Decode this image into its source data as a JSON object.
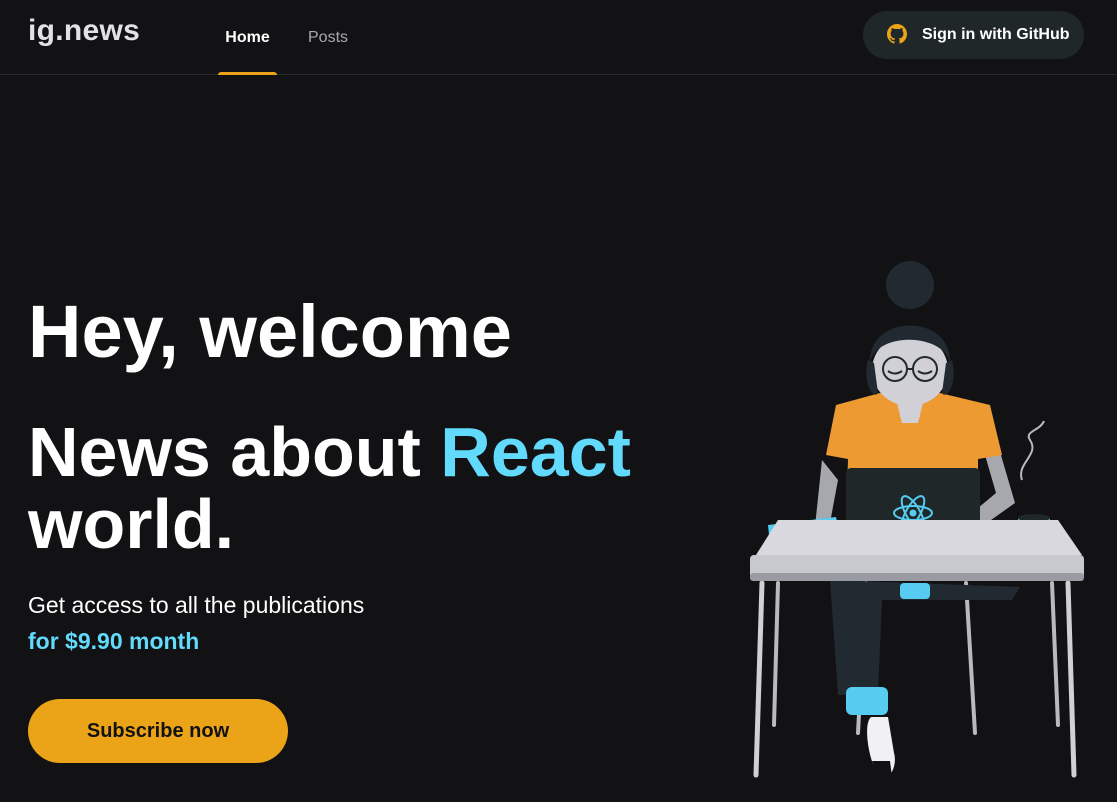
{
  "header": {
    "logo": "ig.news",
    "nav": [
      {
        "label": "Home",
        "active": true
      },
      {
        "label": "Posts",
        "active": false
      }
    ],
    "signin": {
      "label": "Sign in with GitHub",
      "icon": "github-icon"
    }
  },
  "hero": {
    "greeting": "Hey, welcome",
    "headline_start": "News about ",
    "headline_accent": "React",
    "headline_end": "world.",
    "subtitle": "Get access to all the publications",
    "price": "for $9.90 month",
    "cta": "Subscribe now"
  },
  "illustration": {
    "subject": "woman-with-react-laptop",
    "icon": "react-logo-icon"
  },
  "colors": {
    "background": "#121214",
    "accent_orange": "#eba417",
    "react_cyan": "#61dafb",
    "button_dark": "#1f2729"
  }
}
